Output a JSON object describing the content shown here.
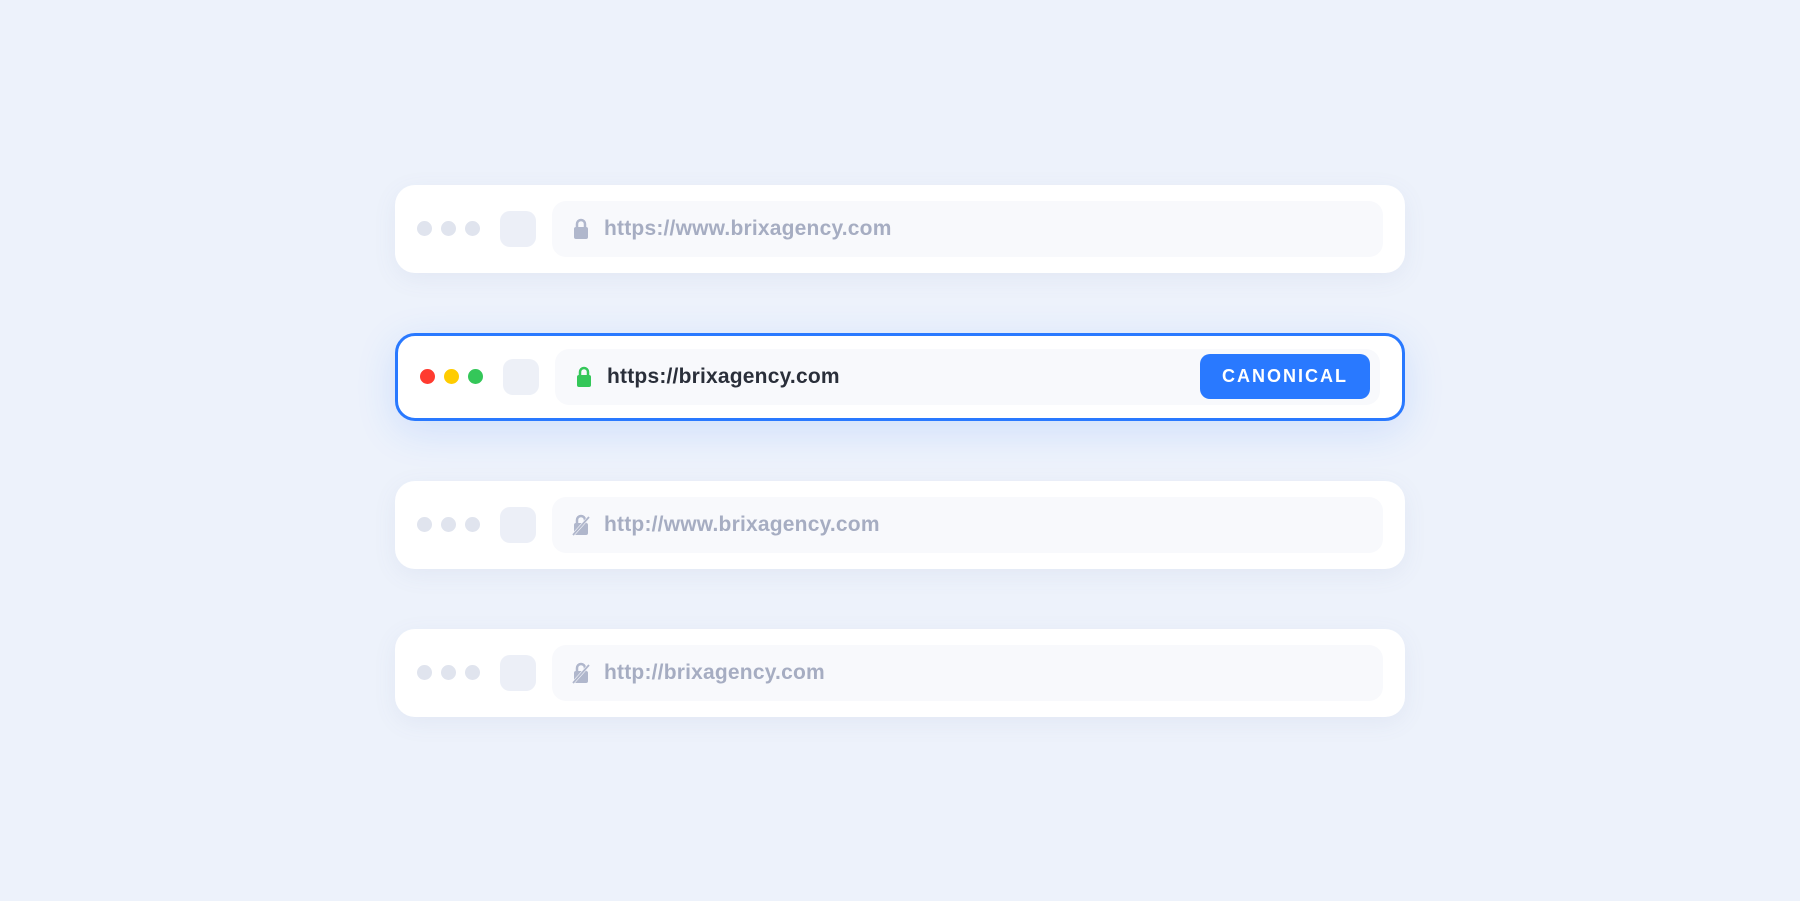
{
  "bars": [
    {
      "url": "https://www.brixagency.com",
      "secure": true,
      "active": false,
      "badge": null
    },
    {
      "url": "https://brixagency.com",
      "secure": true,
      "active": true,
      "badge": "CANONICAL"
    },
    {
      "url": "http://www.brixagency.com",
      "secure": false,
      "active": false,
      "badge": null
    },
    {
      "url": "http://brixagency.com",
      "secure": false,
      "active": false,
      "badge": null
    }
  ],
  "colors": {
    "accent": "#2979ff",
    "inactive_text": "#a6adc2",
    "active_text": "#2a2f3a",
    "secure_lock": "#34c759",
    "muted_lock": "#b0b7cc"
  }
}
